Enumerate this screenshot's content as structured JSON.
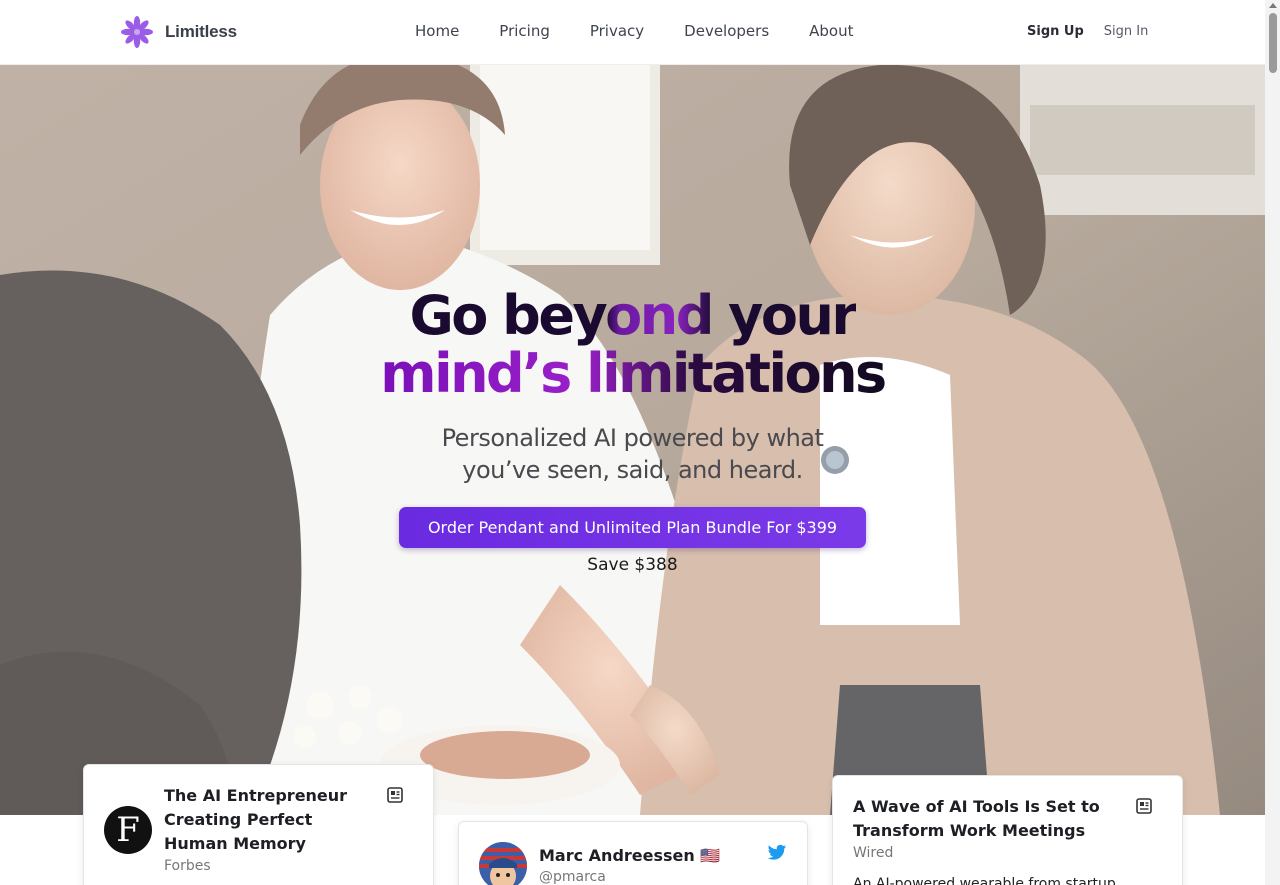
{
  "brand": {
    "name": "Limitless",
    "accent": "#7b3ae8"
  },
  "nav": {
    "items": [
      "Home",
      "Pricing",
      "Privacy",
      "Developers",
      "About"
    ]
  },
  "auth": {
    "sign_up": "Sign Up",
    "sign_in": "Sign In"
  },
  "hero": {
    "headline_line1": "Go beyond your",
    "headline_line2": "mind’s limitations",
    "subhead_line1": "Personalized AI powered by what",
    "subhead_line2": "you’ve seen, said, and heard.",
    "cta_label": "Order Pendant and Unlimited Plan Bundle For $399",
    "save_text": "Save $388"
  },
  "cards": {
    "forbes": {
      "title": "The AI Entrepreneur Creating Perfect Human Memory",
      "source": "Forbes",
      "logo_letter": "F",
      "icon": "article-icon"
    },
    "tweet": {
      "name": "Marc Andreessen 🇺🇸",
      "handle": "@pmarca",
      "icon": "twitter-icon"
    },
    "wired": {
      "title": "A Wave of AI Tools Is Set to Transform Work Meetings",
      "source": "Wired",
      "excerpt": "An AI-powered wearable from startup",
      "icon": "article-icon"
    }
  }
}
